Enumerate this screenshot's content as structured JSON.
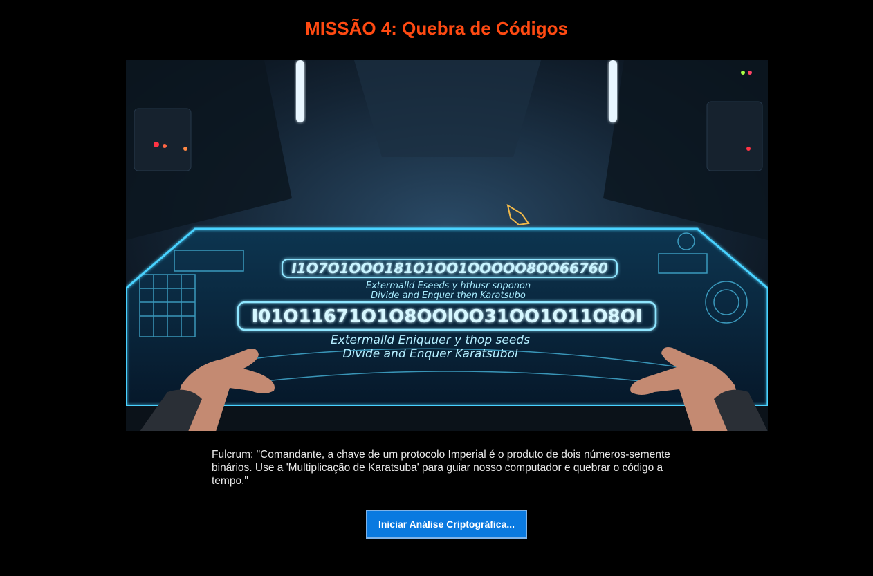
{
  "mission": {
    "title": "MISSÃO 4: Quebra de Códigos"
  },
  "scene": {
    "hologram_lines": [
      "I1O7O1OOO181O1OO1OOOOO8OO66760",
      "Extermalld Eseeds y hthusr snponon",
      "Divide and Enquer then Karatsubo",
      "I01O11671O1O8OOlOO31OO1O11O8OI",
      "Extermalld Eniquuer y thop seeds",
      "Divide and Enquer Karatsubol"
    ]
  },
  "dialogue": {
    "text": "Fulcrum: \"Comandante, a chave de um protocolo Imperial é o produto de dois números-semente binários. Use a 'Multiplicação de Karatsuba' para guiar nosso computador e quebrar o código a tempo.\""
  },
  "actions": {
    "start_label": "Iniciar Análise Criptográfica..."
  },
  "colors": {
    "title": "#ff4a12",
    "button": "#0a7ae0",
    "hologram": "#5fd4ff"
  }
}
